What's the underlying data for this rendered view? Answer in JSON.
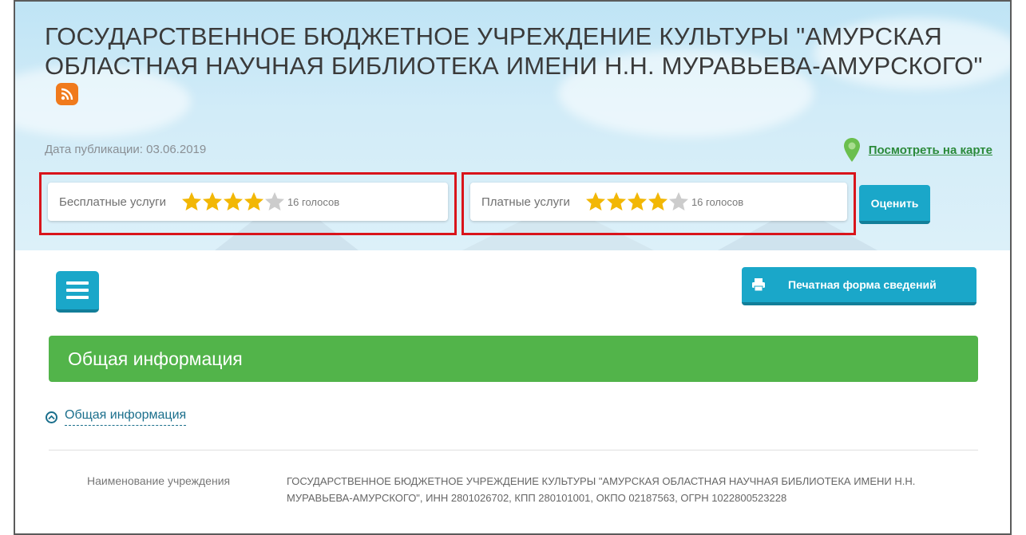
{
  "header": {
    "title": "ГОСУДАРСТВЕННОЕ БЮДЖЕТНОЕ УЧРЕЖДЕНИЕ КУЛЬТУРЫ \"АМУРСКАЯ ОБЛАСТНАЯ НАУЧНАЯ БИБЛИОТЕКА ИМЕНИ Н.Н. МУРАВЬЕВА-АМУРСКОГО\"",
    "publication_date": "Дата публикации: 03.06.2019",
    "map_link": "Посмотреть на карте",
    "rss_icon": "rss-icon",
    "map_icon": "map-pin-icon"
  },
  "ratings": [
    {
      "label": "Бесплатные услуги",
      "stars_filled": 4,
      "stars_total": 5,
      "votes": "16 голосов"
    },
    {
      "label": "Платные услуги",
      "stars_filled": 4,
      "stars_total": 5,
      "votes": "16 голосов"
    }
  ],
  "rate_button": "Оценить",
  "toolbar": {
    "menu_icon": "hamburger-menu-icon",
    "print_button": "Печатная форма сведений",
    "print_icon": "printer-icon"
  },
  "section": {
    "title": "Общая информация",
    "toggle_label": "Общая информация",
    "toggle_icon": "chevron-up-circle-icon"
  },
  "fields": [
    {
      "label": "Наименование учреждения",
      "value": "ГОСУДАРСТВЕННОЕ БЮДЖЕТНОЕ УЧРЕЖДЕНИЕ КУЛЬТУРЫ \"АМУРСКАЯ ОБЛАСТНАЯ НАУЧНАЯ БИБЛИОТЕКА ИМЕНИ Н.Н. МУРАВЬЕВА-АМУРСКОГО\", ИНН 2801026702, КПП 280101001, ОКПО 02187563, ОГРН 1022800523228"
    }
  ],
  "colors": {
    "accent": "#1aa7c9",
    "section_green": "#52b44a",
    "highlight_red": "#d9141b",
    "star_gold": "#f2b705",
    "star_grey": "#cccccc",
    "link_green": "#2b8a3a"
  }
}
